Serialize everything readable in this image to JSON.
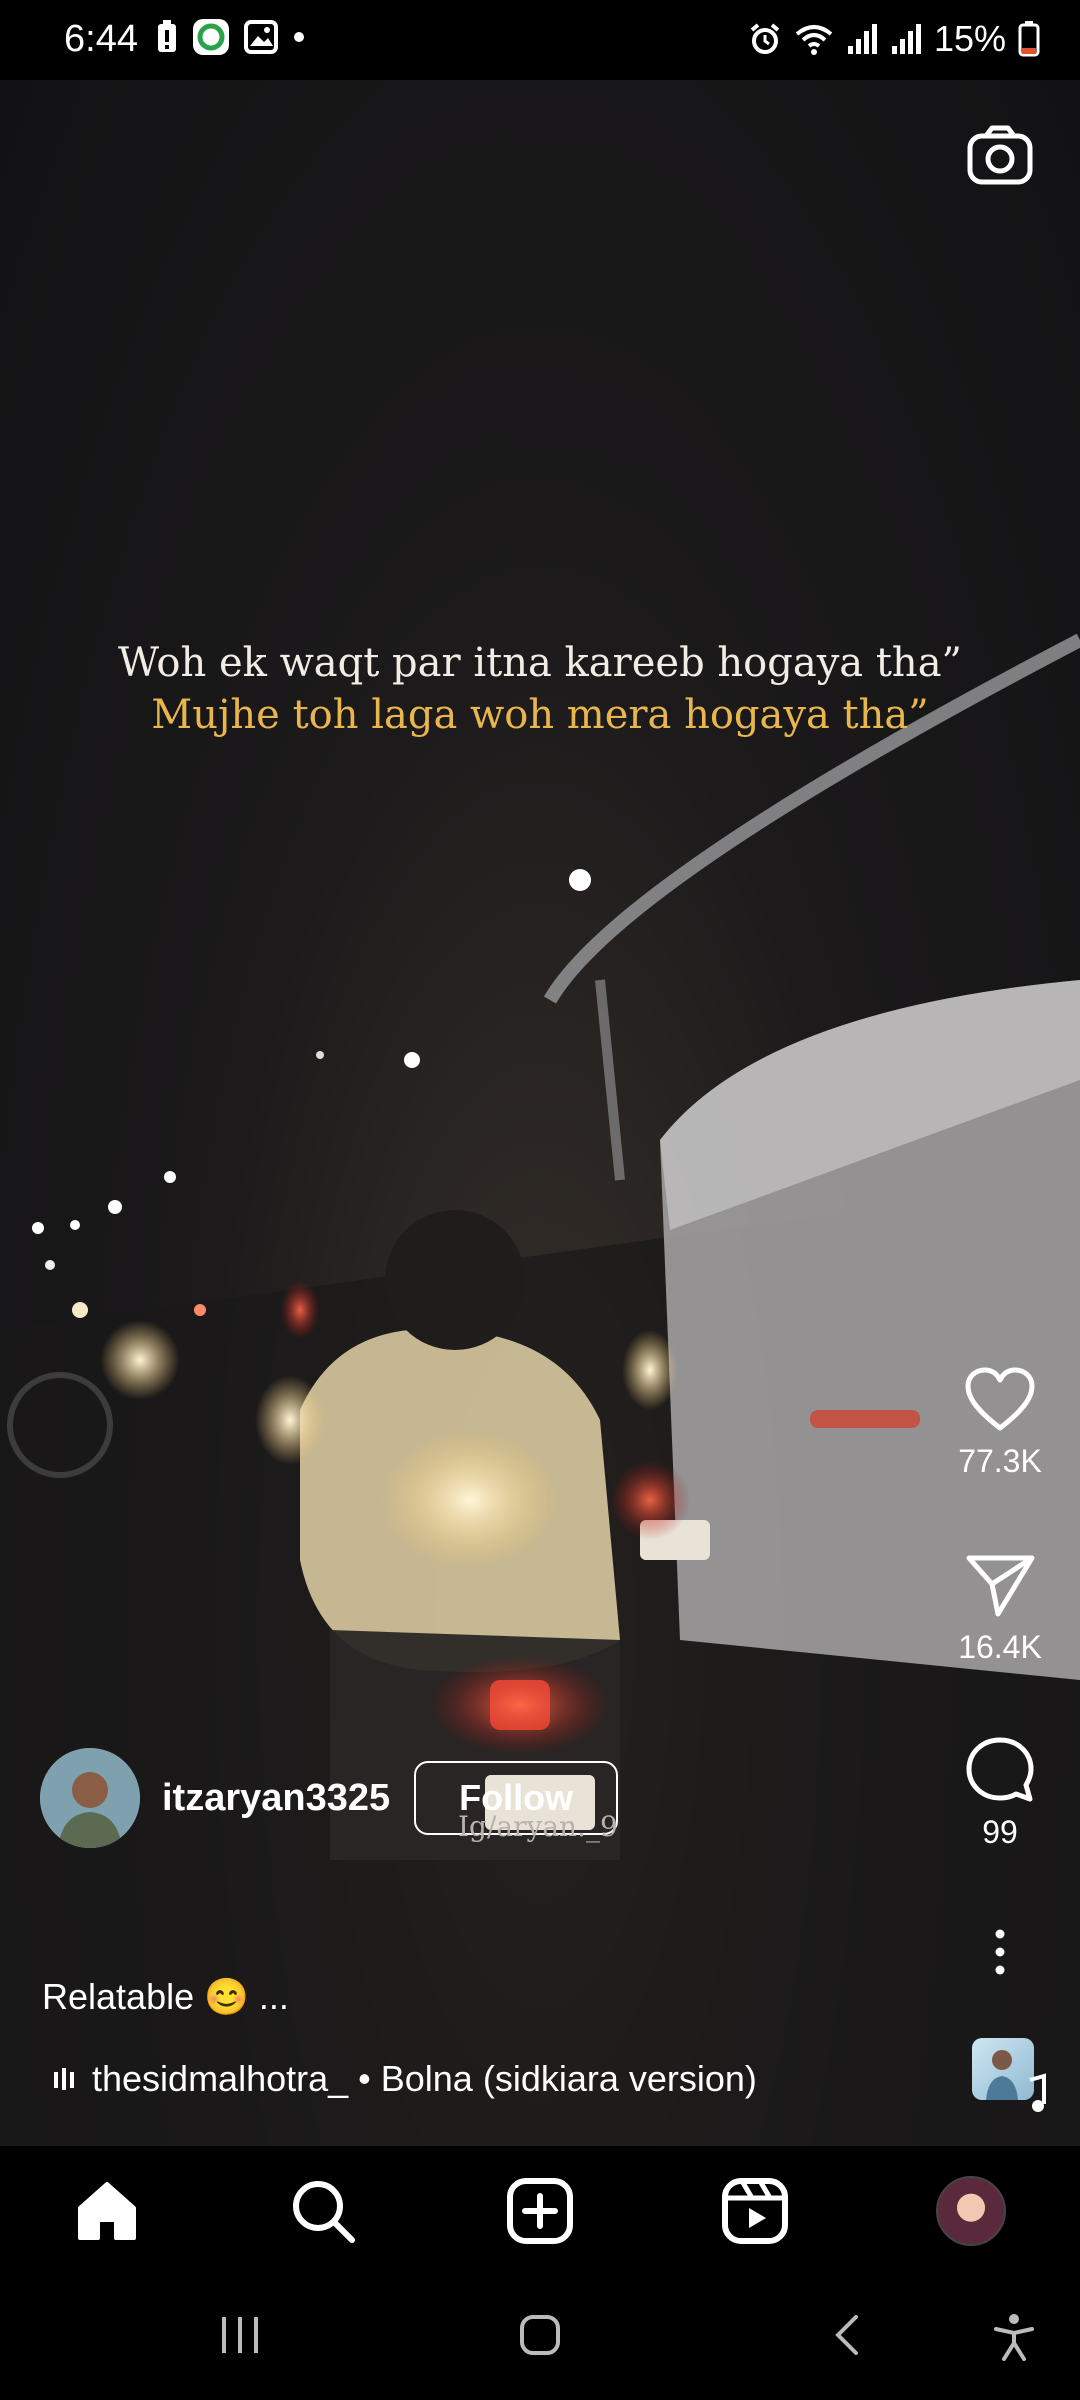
{
  "status_bar": {
    "time": "6:44",
    "battery": "15%"
  },
  "overlay": {
    "line1": "Woh ek waqt par itna kareeb hogaya tha”",
    "line2": "Mujhe toh laga woh mera hogaya tha”"
  },
  "actions": {
    "likes": "77.3K",
    "shares": "16.4K",
    "comments": "99"
  },
  "author": {
    "username": "itzaryan3325",
    "follow_label": "Follow",
    "watermark": "Ig/aryan._9"
  },
  "caption": "Relatable 😊 ...",
  "audio": {
    "label": "thesidmalhotra_ • Bolna (sidkiara version)"
  },
  "colors": {
    "caption_accent": "#e8b64c",
    "battery_low": "#e0532f"
  },
  "icons": {
    "camera": "camera-icon",
    "like": "heart-icon",
    "share": "send-icon",
    "comment": "comment-icon",
    "more": "more-vertical-icon",
    "home": "home-icon",
    "search": "search-icon",
    "create": "plus-square-icon",
    "reels": "reels-icon"
  }
}
